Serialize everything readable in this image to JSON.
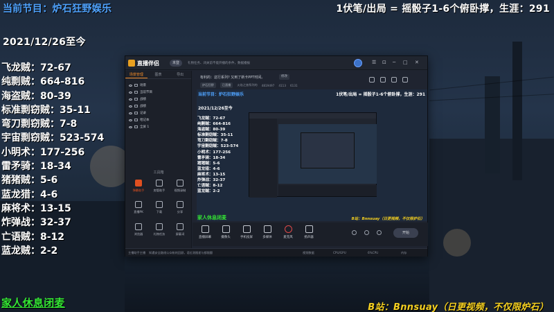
{
  "overlay": {
    "current_program": "当前节目：炉石狂野娱乐",
    "rule": "1伏笔/出局 = 摇骰子1-6个俯卧撑，生涯：291",
    "date": "2021/12/26至今",
    "scores": [
      "飞龙贼：72-67",
      "纯剽贼：664-816",
      "海盗贼：80-39",
      "标准剽窃贼：35-11",
      "弯刀剽窃贼：7-8",
      "宇宙剽窃贼：523-574",
      "小明术：177-256",
      "雷矛骑：18-34",
      "猪猪贼：5-6",
      "蓝龙猎：4-6",
      "麻将术：13-15",
      "炸弹战：32-37",
      "亡语贼：8-12",
      "蓝龙贼：2-2"
    ],
    "family": "家人休息闭麦",
    "bilibili": "B站：Bnnsuay（日更视频，不仅限炉石）"
  },
  "app": {
    "logo_text": "直播伴侣",
    "title_pill": "未登",
    "notice": "礼物任务、闭关前不能开播的条件，数据播报",
    "left_tabs": [
      "场景管理",
      "图表",
      "导出"
    ],
    "scenes": [
      "场景",
      "当前节目",
      "战绩",
      "战绩",
      "记录",
      "哈记本",
      "全屏 1"
    ],
    "tools_label": "工具箱",
    "tools": [
      {
        "label": "弹幕助手",
        "icon": "danmaku-icon"
      },
      {
        "label": "房管助手",
        "icon": "user-icon"
      },
      {
        "label": "视频录制",
        "icon": "record-icon"
      },
      {
        "label": "直播PK",
        "icon": "pk-icon"
      },
      {
        "label": "下载",
        "icon": "download-icon"
      },
      {
        "label": "分享",
        "icon": "share-icon"
      },
      {
        "label": "浏览器",
        "icon": "browser-icon"
      },
      {
        "label": "礼物任务",
        "icon": "gift-icon"
      },
      {
        "label": "屏蔽词",
        "icon": "block-icon"
      }
    ],
    "top_line": "有利的：这行系列? 又到了新卡PPT时间。",
    "top_btn": "修改",
    "top_chips": [
      "炉石狂野",
      "已直播"
    ],
    "stats": [
      "火焰之旅系列的",
      "4819497",
      "4113",
      "6131"
    ],
    "controls": [
      {
        "label": "直播屏幕",
        "icon": "screen-icon"
      },
      {
        "label": "摄像头",
        "icon": "camera-icon"
      },
      {
        "label": "手机投屏",
        "icon": "phone-icon"
      },
      {
        "label": "多媒体",
        "icon": "media-icon"
      },
      {
        "label": "麦克风",
        "icon": "mic-icon"
      },
      {
        "label": "扬声器",
        "icon": "speaker-icon"
      }
    ],
    "start_label": "开始",
    "status": [
      "主播助手主播",
      "知遇安全路线公众帐的回顾，语位测限差与都限额",
      "视频数据",
      "CPU/GPU",
      "6%CPU",
      "内存"
    ]
  }
}
